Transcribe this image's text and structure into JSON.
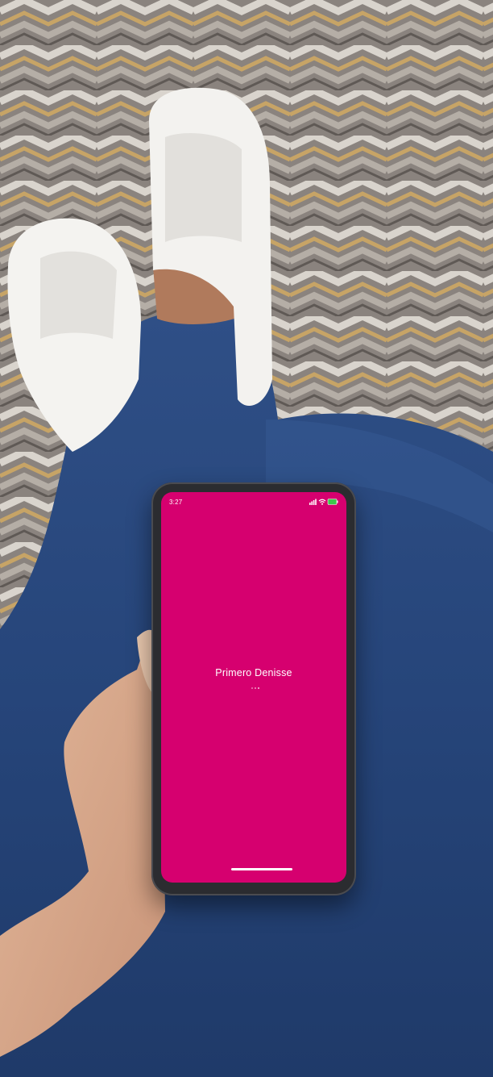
{
  "screen": {
    "background_color": "#d6006f",
    "status_bar": {
      "time": "3:27",
      "icons": [
        "signal-icon",
        "wifi-icon",
        "battery-icon"
      ]
    },
    "title": "Primero Denisse",
    "loading_indicator": "loading-dots-icon"
  }
}
